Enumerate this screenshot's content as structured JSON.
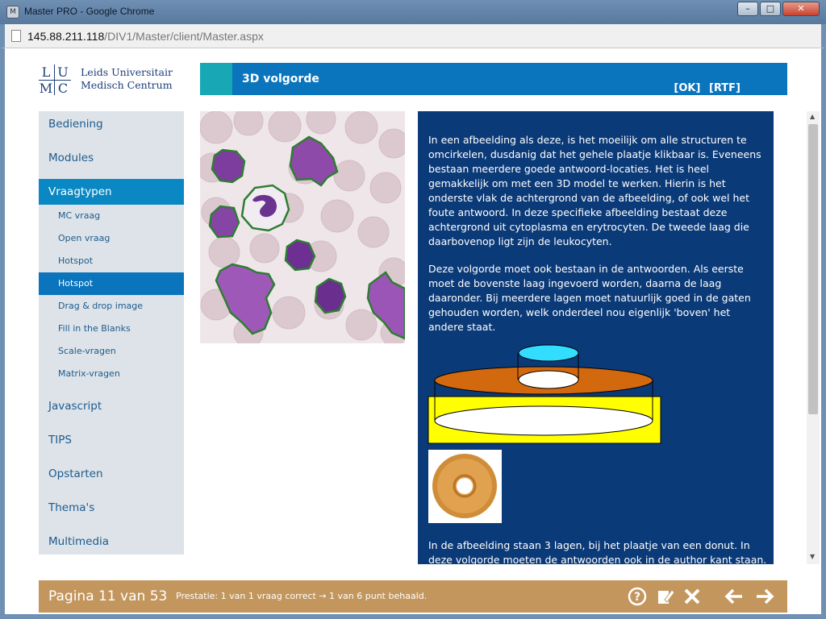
{
  "window": {
    "title": "Master PRO - Google Chrome"
  },
  "address": {
    "host": "145.88.211.118",
    "path": "/DIV1/Master/client/Master.aspx"
  },
  "logo": {
    "letters": [
      "L",
      "U",
      "M",
      "C"
    ],
    "line1": "Leids Universitair",
    "line2": "Medisch Centrum"
  },
  "header": {
    "title": "3D volgorde",
    "ok": "[OK]",
    "rtf": "[RTF]"
  },
  "sidebar": {
    "items": [
      {
        "label": "Bediening"
      },
      {
        "label": "Modules"
      },
      {
        "label": "Vraagtypen"
      },
      {
        "label": "Javascript"
      },
      {
        "label": "TIPS"
      },
      {
        "label": "Opstarten"
      },
      {
        "label": "Thema's"
      },
      {
        "label": "Multimedia"
      }
    ],
    "subitems": [
      {
        "label": "MC vraag"
      },
      {
        "label": "Open vraag"
      },
      {
        "label": "Hotspot"
      },
      {
        "label": "Hotspot"
      },
      {
        "label": "Drag & drop image"
      },
      {
        "label": "Fill in the Blanks"
      },
      {
        "label": "Scale-vragen"
      },
      {
        "label": "Matrix-vragen"
      }
    ]
  },
  "content": {
    "p1": "In een afbeelding als deze, is het moeilijk om alle structuren te omcirkelen, dusdanig dat het gehele plaatje klikbaar is. Eveneens bestaan meerdere goede antwoord-locaties. Het is heel gemakkelijk om met een 3D model te werken. Hierin is het onderste vlak de achtergrond van de afbeelding, of ook wel het foute antwoord. In deze specifieke afbeelding bestaat deze achtergrond uit cytoplasma en erytrocyten. De tweede laag die daarbovenop ligt zijn de leukocyten.",
    "p2": "Deze volgorde moet ook bestaan in de antwoorden. Als eerste moet de bovenste laag ingevoerd worden, daarna de laag daaronder. Bij meerdere lagen moet natuurlijk goed in de gaten gehouden worden, welk onderdeel nou eigenlijk 'boven' het andere staat.",
    "p3": "In de afbeelding staan 3 lagen, bij het plaatje van een donut. In deze volgorde moeten de antwoorden ook in de author kant staan."
  },
  "footer": {
    "page": "Pagina 11 van 53",
    "status": "Prestatie: 1 van 1 vraag correct → 1 van 6 punt behaald."
  },
  "icons": {
    "help": "help-icon",
    "edit": "edit-note-icon",
    "close": "close-icon",
    "prev": "arrow-left-icon",
    "next": "arrow-right-icon"
  },
  "colors": {
    "header": "#0a74bd",
    "panel": "#0b3a78",
    "footer": "#c3965e",
    "active": "#0a88c4"
  }
}
